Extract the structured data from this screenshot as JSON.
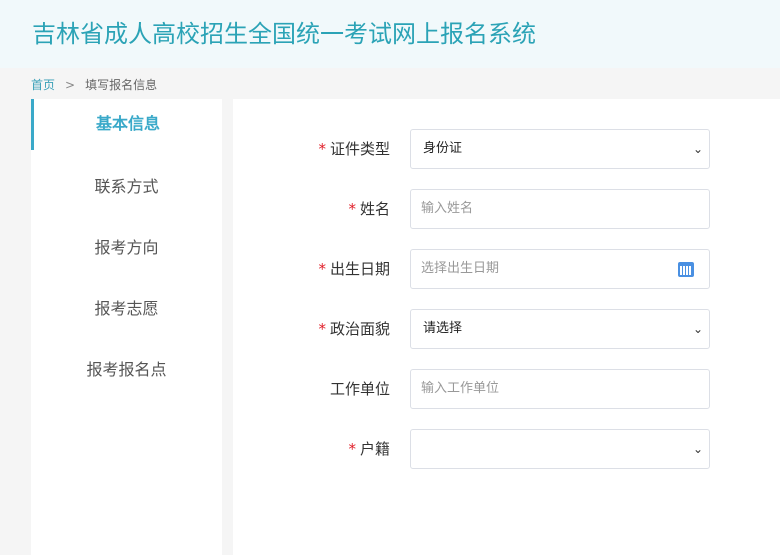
{
  "header": {
    "title": "吉林省成人高校招生全国统一考试网上报名系统"
  },
  "breadcrumb": {
    "home": "首页",
    "sep": ">",
    "current": "填写报名信息"
  },
  "sidebar": {
    "items": [
      {
        "label": "基本信息"
      },
      {
        "label": "联系方式"
      },
      {
        "label": "报考方向"
      },
      {
        "label": "报考志愿"
      },
      {
        "label": "报考报名点"
      }
    ]
  },
  "form": {
    "required_mark": "*",
    "id_type": {
      "label": "证件类型",
      "value": "身份证"
    },
    "name": {
      "label": "姓名",
      "placeholder": "输入姓名"
    },
    "birth": {
      "label": "出生日期",
      "placeholder": "选择出生日期"
    },
    "political": {
      "label": "政治面貌",
      "value": "请选择"
    },
    "work": {
      "label": "工作单位",
      "placeholder": "输入工作单位"
    },
    "household": {
      "label": "户籍",
      "value": ""
    }
  },
  "colors": {
    "accent": "#3aa9c9",
    "title": "#2ba3b6",
    "required": "#e0202a"
  }
}
